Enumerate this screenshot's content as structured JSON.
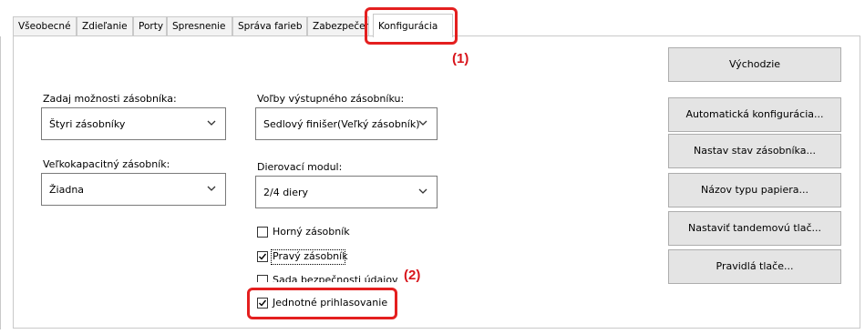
{
  "tabs": [
    {
      "label": "Všeobecné"
    },
    {
      "label": "Zdieľanie"
    },
    {
      "label": "Porty"
    },
    {
      "label": "Spresnenie"
    },
    {
      "label": "Správa farieb"
    },
    {
      "label": "Zabezpečer"
    },
    {
      "label": "Konfigurácia",
      "active": true
    }
  ],
  "callouts": {
    "one": "(1)",
    "two": "(2)"
  },
  "left": {
    "tray_options_label": "Zadaj možnosti zásobníka:",
    "tray_options_value": "Štyri zásobníky",
    "hc_tray_label": "Veľkokapacitný zásobník:",
    "hc_tray_value": "Žiadna"
  },
  "middle": {
    "output_label": "Voľby výstupného zásobníku:",
    "output_value": "Sedlový finišer(Veľký zásobník)",
    "punch_label": "Dierovací modul:",
    "punch_value": "2/4 diery",
    "checkboxes": [
      {
        "label": "Horný zásobník",
        "checked": false
      },
      {
        "label": "Pravý zásobník",
        "checked": true
      },
      {
        "label": "Sada bezpečnosti údajov",
        "checked": false
      },
      {
        "label": "Jednotné prihlasovanie",
        "checked": true
      }
    ]
  },
  "buttons": {
    "defaults": "Východzie",
    "auto_config": "Automatická konfigurácia...",
    "tray_status": "Nastav stav zásobníka...",
    "paper_type": "Názov typu papiera...",
    "tandem": "Nastaviť tandemovú tlač...",
    "print_rules": "Pravidlá tlače..."
  },
  "colors": {
    "callout_red": "#e41f1f",
    "button_face": "#e4e4e4"
  }
}
